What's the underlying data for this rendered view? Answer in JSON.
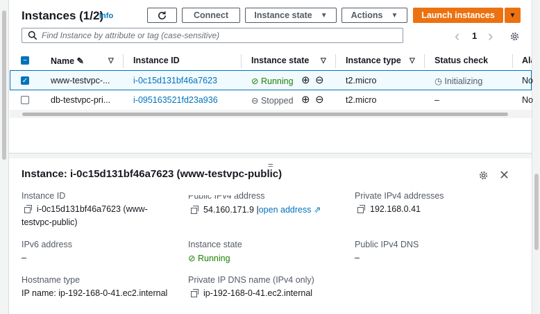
{
  "header": {
    "title": "Instances (1/2)",
    "info": "Info",
    "refresh_icon": "refresh-icon",
    "connect": "Connect",
    "instance_state": "Instance state",
    "actions": "Actions",
    "launch": "Launch instances"
  },
  "search": {
    "placeholder": "Find Instance by attribute or tag (case-sensitive)"
  },
  "pager": {
    "page": "1",
    "prev": "‹",
    "next": "›"
  },
  "table": {
    "columns": [
      "Name",
      "Instance ID",
      "Instance state",
      "Instance type",
      "Status check",
      "Ala"
    ],
    "rows": [
      {
        "name": "www-testvpc-...",
        "id": "i-0c15d131bf46a7623",
        "state": "Running",
        "type": "t2.micro",
        "status": "Initializing",
        "alarm": "No",
        "selected": true
      },
      {
        "name": "db-testvpc-pri...",
        "id": "i-095163521fd23a936",
        "state": "Stopped",
        "type": "t2.micro",
        "status": "–",
        "alarm": "No",
        "selected": false
      }
    ]
  },
  "detail": {
    "drag": "=",
    "title": "Instance: i-0c15d131bf46a7623 (www-testvpc-public)",
    "instance_id_label": "Instance ID",
    "instance_id_line1": "i-0c15d131bf46a7623 (www-",
    "instance_id_line2": "testvpc-public)",
    "public_ipv4_label": "Public IPv4 address",
    "public_ipv4": "54.160.171.9",
    "open_address": "open address",
    "private_ipv4_label": "Private IPv4 addresses",
    "private_ipv4": "192.168.0.41",
    "ipv6_label": "IPv6 address",
    "ipv6": "–",
    "state_label": "Instance state",
    "state": "Running",
    "public_dns_label": "Public IPv4 DNS",
    "public_dns": "–",
    "hostname_type_label": "Hostname type",
    "hostname_type": "IP name: ip-192-168-0-41.ec2.internal",
    "private_dns_label": "Private IP DNS name (IPv4 only)",
    "private_dns": "ip-192-168-0-41.ec2.internal"
  },
  "colors": {
    "accent": "#0073bb",
    "launch": "#ec7211",
    "running": "#1d8102"
  }
}
